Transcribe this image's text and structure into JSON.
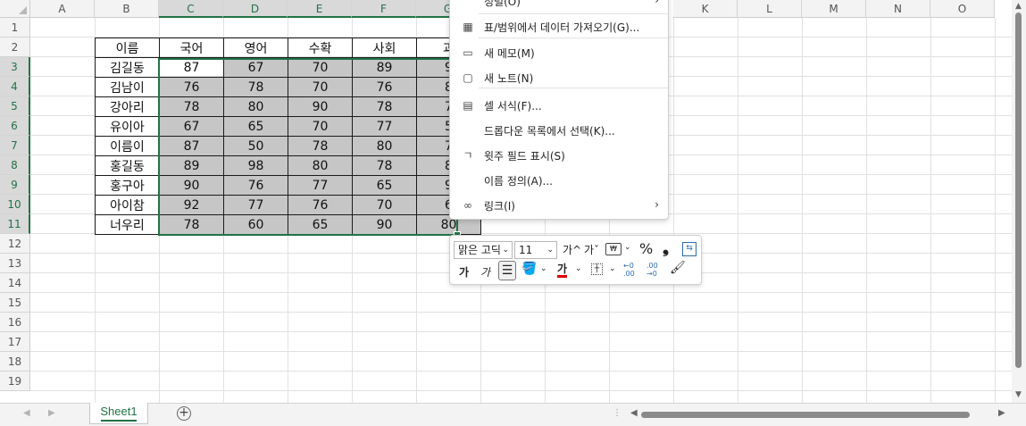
{
  "columns": [
    "A",
    "B",
    "C",
    "D",
    "E",
    "F",
    "G",
    "K",
    "L",
    "M",
    "N",
    "O"
  ],
  "rows": [
    "1",
    "2",
    "3",
    "4",
    "5",
    "6",
    "7",
    "8",
    "9",
    "10",
    "11",
    "12",
    "13",
    "14",
    "15",
    "16",
    "17",
    "18",
    "19"
  ],
  "table": {
    "headers": [
      "이름",
      "국어",
      "영어",
      "수확",
      "사회",
      "과"
    ],
    "rows": [
      {
        "name": "김길동",
        "vals": [
          "87",
          "67",
          "70",
          "89",
          "9"
        ]
      },
      {
        "name": "김남이",
        "vals": [
          "76",
          "78",
          "70",
          "76",
          "8"
        ]
      },
      {
        "name": "강아리",
        "vals": [
          "78",
          "80",
          "90",
          "78",
          "7"
        ]
      },
      {
        "name": "유이아",
        "vals": [
          "67",
          "65",
          "70",
          "77",
          "5"
        ]
      },
      {
        "name": "이름이",
        "vals": [
          "87",
          "50",
          "78",
          "80",
          "7"
        ]
      },
      {
        "name": "홍길동",
        "vals": [
          "89",
          "98",
          "80",
          "78",
          "8"
        ]
      },
      {
        "name": "홍구아",
        "vals": [
          "90",
          "76",
          "77",
          "65",
          "9"
        ]
      },
      {
        "name": "아이참",
        "vals": [
          "92",
          "77",
          "76",
          "70",
          "6"
        ]
      },
      {
        "name": "너우리",
        "vals": [
          "78",
          "60",
          "65",
          "90",
          "80"
        ]
      }
    ]
  },
  "context_menu": {
    "items": [
      {
        "icon": "table-import-icon",
        "label": "표/범위에서 데이터 가져오기(G)..."
      },
      {
        "icon": "new-comment-icon",
        "label": "새 메모(M)"
      },
      {
        "icon": "new-note-icon",
        "label": "새 노트(N)"
      },
      {
        "icon": "format-cells-icon",
        "label": "셀 서식(F)..."
      },
      {
        "icon": "",
        "label": "드롭다운 목록에서 선택(K)..."
      },
      {
        "icon": "phonetic-icon",
        "label": "윗주 필드 표시(S)"
      },
      {
        "icon": "",
        "label": "이름 정의(A)..."
      },
      {
        "icon": "link-icon",
        "label": "링크(I)"
      }
    ],
    "partial_top": "정렬(O)"
  },
  "mini_toolbar": {
    "font_name": "맑은 고딕",
    "font_size": "11",
    "grow_font": "가^",
    "shrink_font": "가ˇ",
    "percent": "%",
    "comma": "❟",
    "bold": "가",
    "italic": "가",
    "font_color_glyph": "가",
    "dec_increase": "←0\n.00",
    "dec_decrease": ".00\n→0"
  },
  "sheet_tab": "Sheet1",
  "colors": {
    "accent": "#217346",
    "selection_fill": "#c6c6c6",
    "font_color_bar": "#e00000"
  }
}
